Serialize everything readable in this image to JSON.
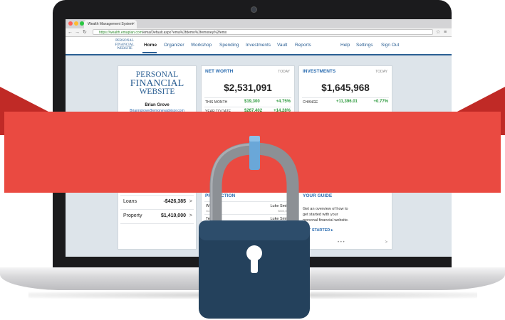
{
  "browser": {
    "tab_title": "Wealth Management System",
    "tab_close": "×",
    "url_secure": "https://wealth.emaplan.com",
    "url_rest": "/ema/Default.aspx?ema%2fdemo%2femoney%2femx",
    "back_icon": "back-arrow-icon",
    "forward_icon": "forward-arrow-icon",
    "reload_icon": "reload-icon",
    "star_icon": "star-icon",
    "menu_icon": "menu-icon",
    "traffic_colors": [
      "#ff5f57",
      "#febc2e",
      "#28c840"
    ]
  },
  "site": {
    "logo_line1": "PERSONAL",
    "logo_line2": "FINANCIAL",
    "logo_line3": "WEBSITE",
    "nav": [
      "Home",
      "Organizer",
      "Workshop",
      "Spending",
      "Investments",
      "Vault",
      "Reports"
    ],
    "nav_right": [
      "Help",
      "Settings",
      "Sign Out"
    ],
    "accent": "#2b5f93"
  },
  "profile_card": {
    "logo_line1": "PERSONAL",
    "logo_line2": "FINANCIAL",
    "logo_line3": "WEBSITE",
    "name": "Brian Grove",
    "email": "Brianngrove@emoneyadvisor.com",
    "accounts": [
      {
        "label": "Loans",
        "value": "-$426,385",
        "chevron": ">"
      },
      {
        "label": "Property",
        "value": "$1,410,000",
        "chevron": ">"
      }
    ]
  },
  "net_worth": {
    "title": "NET WORTH",
    "period": "TODAY",
    "value": "$2,531,091",
    "rows": [
      {
        "label": "THIS MONTH",
        "amount": "$19,300",
        "pct": "+4.75%"
      },
      {
        "label": "YEAR TO DATE",
        "amount": "$267,402",
        "pct": "+14.28%"
      }
    ]
  },
  "investments": {
    "title": "INVESTMENTS",
    "period": "TODAY",
    "value": "$1,645,968",
    "rows": [
      {
        "label": "CHANGE",
        "amount": "+11,396.01",
        "pct": "+0.77%"
      }
    ]
  },
  "projection": {
    "title": "PROJECTION",
    "rows": [
      {
        "left": "Wh",
        "left_sub": "Goa",
        "name": "Luke Smith",
        "sub": "$500,000"
      },
      {
        "left": "Ter",
        "left_sub": "",
        "name": "Luke Smith",
        "sub": "$500,000"
      }
    ]
  },
  "guide": {
    "title": "YOUR GUIDE",
    "lines": [
      "Get an overview of how to",
      "get started with your",
      "personal financial website."
    ],
    "link": "GET STARTED ▸",
    "dots": "• • •",
    "chevron": ">"
  },
  "overlay": {
    "banner_color": "#ea4a41",
    "banner_fold_color": "#c02a26",
    "lock_body_color": "#24415c",
    "lock_shackle_color": "#8c9095",
    "lock_clip_color": "#6aa7d8",
    "lock_icon": "padlock-icon",
    "keyhole_icon": "keyhole-icon"
  }
}
